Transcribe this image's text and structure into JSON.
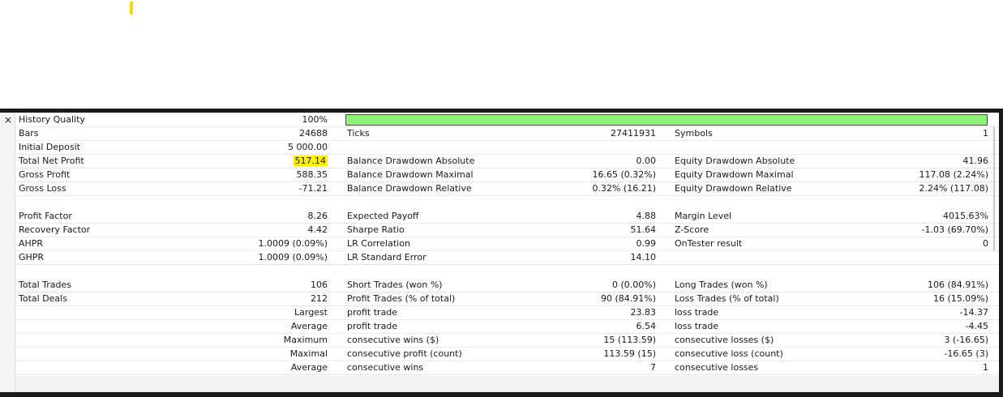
{
  "rows": [
    {
      "l1": "History Quality",
      "v1": "100%",
      "progress": 1.0
    },
    {
      "l1": "Bars",
      "v1": "24688",
      "l2": "Ticks",
      "v2": "27411931",
      "l3": "Symbols",
      "v3": "1"
    },
    {
      "l1": "Initial Deposit",
      "v1": "5 000.00"
    },
    {
      "l1": "Total Net Profit",
      "v1": "517.14",
      "l2": "Balance Drawdown Absolute",
      "v2": "0.00",
      "l3": "Equity Drawdown Absolute",
      "v3": "41.96"
    },
    {
      "l1": "Gross Profit",
      "v1": "588.35",
      "l2": "Balance Drawdown Maximal",
      "v2": "16.65 (0.32%)",
      "l3": "Equity Drawdown Maximal",
      "v3": "117.08 (2.24%)"
    },
    {
      "l1": "Gross Loss",
      "v1": "-71.21",
      "l2": "Balance Drawdown Relative",
      "v2": "0.32% (16.21)",
      "l3": "Equity Drawdown Relative",
      "v3": "2.24% (117.08)"
    },
    {
      "l1": "Profit Factor",
      "v1": "8.26",
      "l2": "Expected Payoff",
      "v2": "4.88",
      "l3": "Margin Level",
      "v3": "4015.63%"
    },
    {
      "l1": "Recovery Factor",
      "v1": "4.42",
      "l2": "Sharpe Ratio",
      "v2": "51.64",
      "l3": "Z-Score",
      "v3": "-1.03 (69.70%)"
    },
    {
      "l1": "AHPR",
      "v1": "1.0009 (0.09%)",
      "l2": "LR Correlation",
      "v2": "0.99",
      "l3": "OnTester result",
      "v3": "0"
    },
    {
      "l1": "GHPR",
      "v1": "1.0009 (0.09%)",
      "l2": "LR Standard Error",
      "v2": "14.10"
    },
    {
      "l1": "Total Trades",
      "v1": "106",
      "l2": "Short Trades (won %)",
      "v2": "0 (0.00%)",
      "l3": "Long Trades (won %)",
      "v3": "106 (84.91%)"
    },
    {
      "l1": "Total Deals",
      "v1": "212",
      "l2": "Profit Trades (% of total)",
      "v2": "90 (84.91%)",
      "l3": "Loss Trades (% of total)",
      "v3": "16 (15.09%)"
    },
    {
      "v1": "Largest",
      "l2": "profit trade",
      "v2": "23.83",
      "l3": "loss trade",
      "v3": "-14.37"
    },
    {
      "v1": "Average",
      "l2": "profit trade",
      "v2": "6.54",
      "l3": "loss trade",
      "v3": "-4.45"
    },
    {
      "v1": "Maximum",
      "l2": "consecutive wins ($)",
      "v2": "15 (113.59)",
      "l3": "consecutive losses ($)",
      "v3": "3 (-16.65)"
    },
    {
      "v1": "Maximal",
      "l2": "consecutive profit (count)",
      "v2": "113.59 (15)",
      "l3": "consecutive loss (count)",
      "v3": "-16.65 (3)"
    },
    {
      "v1": "Average",
      "l2": "consecutive wins",
      "v2": "7",
      "l3": "consecutive losses",
      "v3": "1"
    }
  ],
  "close_glyph": "×",
  "colors": {
    "highlight": "#fff200",
    "quality_fill": "#8cf27a"
  }
}
